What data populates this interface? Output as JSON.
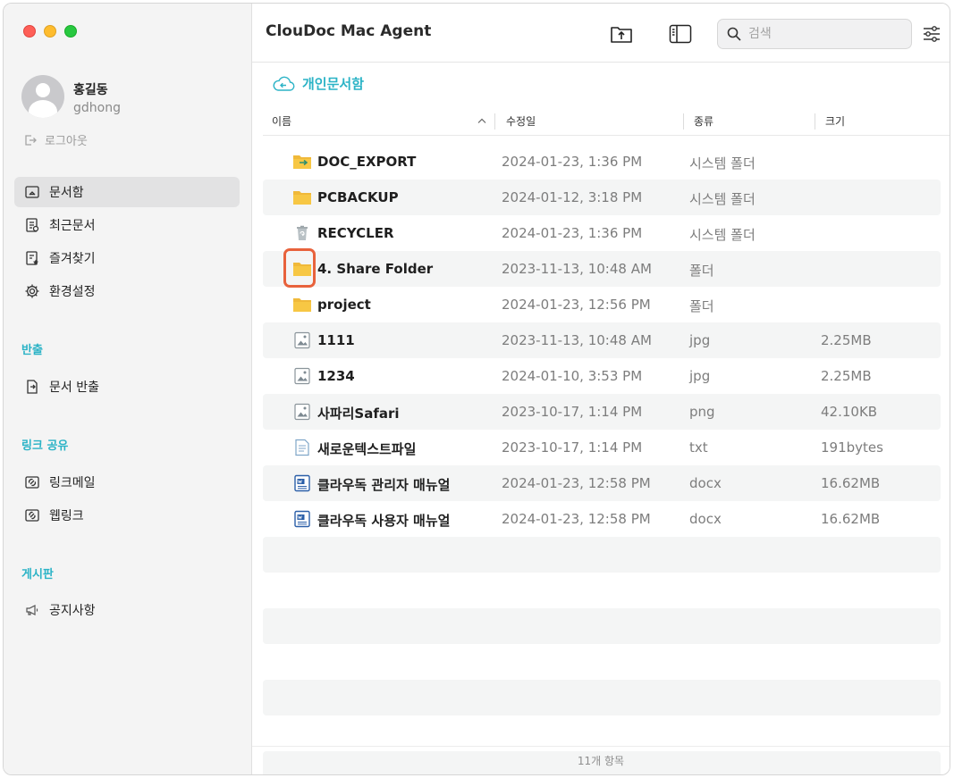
{
  "sidebar": {
    "user": {
      "name": "홍길동",
      "id": "gdhong"
    },
    "logout_label": "로그아웃",
    "nav": [
      {
        "label": "문서함",
        "icon": "document-box-icon",
        "active": true
      },
      {
        "label": "최근문서",
        "icon": "recent-document-icon"
      },
      {
        "label": "즐겨찾기",
        "icon": "favorite-document-icon"
      },
      {
        "label": "환경설정",
        "icon": "gear-icon"
      }
    ],
    "sections": {
      "export": {
        "title": "반출",
        "items": [
          {
            "label": "문서 반출",
            "icon": "export-document-icon"
          }
        ]
      },
      "link_share": {
        "title": "링크 공유",
        "items": [
          {
            "label": "링크메일",
            "icon": "link-mail-icon"
          },
          {
            "label": "웹링크",
            "icon": "web-link-icon"
          }
        ]
      },
      "board": {
        "title": "게시판",
        "items": [
          {
            "label": "공지사항",
            "icon": "megaphone-icon"
          }
        ]
      }
    }
  },
  "toolbar": {
    "title": "ClouDoc Mac Agent",
    "search_placeholder": "검색",
    "upload_icon": "folder-upload-icon",
    "sidebar_toggle_icon": "sidebar-toggle-icon",
    "filter_icon": "filter-sliders-icon"
  },
  "breadcrumb": {
    "label": "개인문서함",
    "icon": "cloud-back-icon"
  },
  "columns": {
    "name": "이름",
    "modified": "수정일",
    "kind": "종류",
    "size": "크기"
  },
  "files": [
    {
      "name": "DOC_EXPORT",
      "modified": "2024-01-23, 1:36 PM",
      "kind": "시스템 폴더",
      "size": "",
      "icon": "export-folder-icon"
    },
    {
      "name": "PCBACKUP",
      "modified": "2024-01-12, 3:18 PM",
      "kind": "시스템 폴더",
      "size": "",
      "icon": "folder-icon"
    },
    {
      "name": "RECYCLER",
      "modified": "2024-01-23, 1:36 PM",
      "kind": "시스템 폴더",
      "size": "",
      "icon": "recycle-bin-icon"
    },
    {
      "name": "4. Share Folder",
      "modified": "2023-11-13, 10:48 AM",
      "kind": "폴더",
      "size": "",
      "icon": "folder-icon"
    },
    {
      "name": "project",
      "modified": "2024-01-23, 12:56 PM",
      "kind": "폴더",
      "size": "",
      "icon": "folder-icon"
    },
    {
      "name": "1111",
      "modified": "2023-11-13, 10:48 AM",
      "kind": "jpg",
      "size": "2.25MB",
      "icon": "image-file-icon"
    },
    {
      "name": "1234",
      "modified": "2024-01-10, 3:53 PM",
      "kind": "jpg",
      "size": "2.25MB",
      "icon": "image-file-icon"
    },
    {
      "name": "사파리Safari",
      "modified": "2023-10-17, 1:14 PM",
      "kind": "png",
      "size": "42.10KB",
      "icon": "image-file-icon"
    },
    {
      "name": "새로운텍스트파일",
      "modified": "2023-10-17, 1:14 PM",
      "kind": "txt",
      "size": "191bytes",
      "icon": "text-file-icon"
    },
    {
      "name": "클라우독 관리자 매뉴얼",
      "modified": "2024-01-23, 12:58 PM",
      "kind": "docx",
      "size": "16.62MB",
      "icon": "word-document-icon"
    },
    {
      "name": "클라우독 사용자 매뉴얼",
      "modified": "2024-01-23, 12:58 PM",
      "kind": "docx",
      "size": "16.62MB",
      "icon": "word-document-icon"
    }
  ],
  "status_bar": {
    "count_label": "11개 항목"
  },
  "colors": {
    "accent": "#2bb3c6",
    "folder": "#f7c744",
    "highlight": "#e8623c"
  }
}
